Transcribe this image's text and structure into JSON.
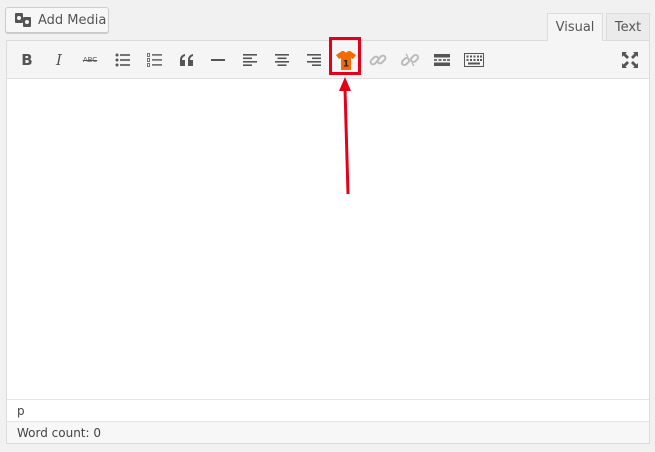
{
  "header": {
    "add_media_label": "Add Media"
  },
  "tabs": [
    {
      "label": "Visual",
      "active": true
    },
    {
      "label": "Text",
      "active": false
    }
  ],
  "toolbar": {
    "bold_label": "B",
    "italic_label": "I",
    "strikethrough_label": "ABC",
    "blockquote_label": "“",
    "custom_badge_number": "1",
    "icons": [
      "bold-icon",
      "italic-icon",
      "strikethrough-icon",
      "bullet-list-icon",
      "numbered-list-icon",
      "blockquote-icon",
      "horizontal-line-icon",
      "align-left-icon",
      "align-center-icon",
      "align-right-icon",
      "tshirt-number-icon",
      "link-icon",
      "unlink-icon",
      "read-more-icon",
      "toolbar-toggle-icon",
      "fullscreen-icon"
    ]
  },
  "status": {
    "path": "p",
    "word_count": "Word count: 0"
  },
  "colors": {
    "highlight": "#e5001a",
    "tshirt": "#f56a00",
    "icon": "#555555",
    "icon_disabled": "#bbbbbb"
  }
}
